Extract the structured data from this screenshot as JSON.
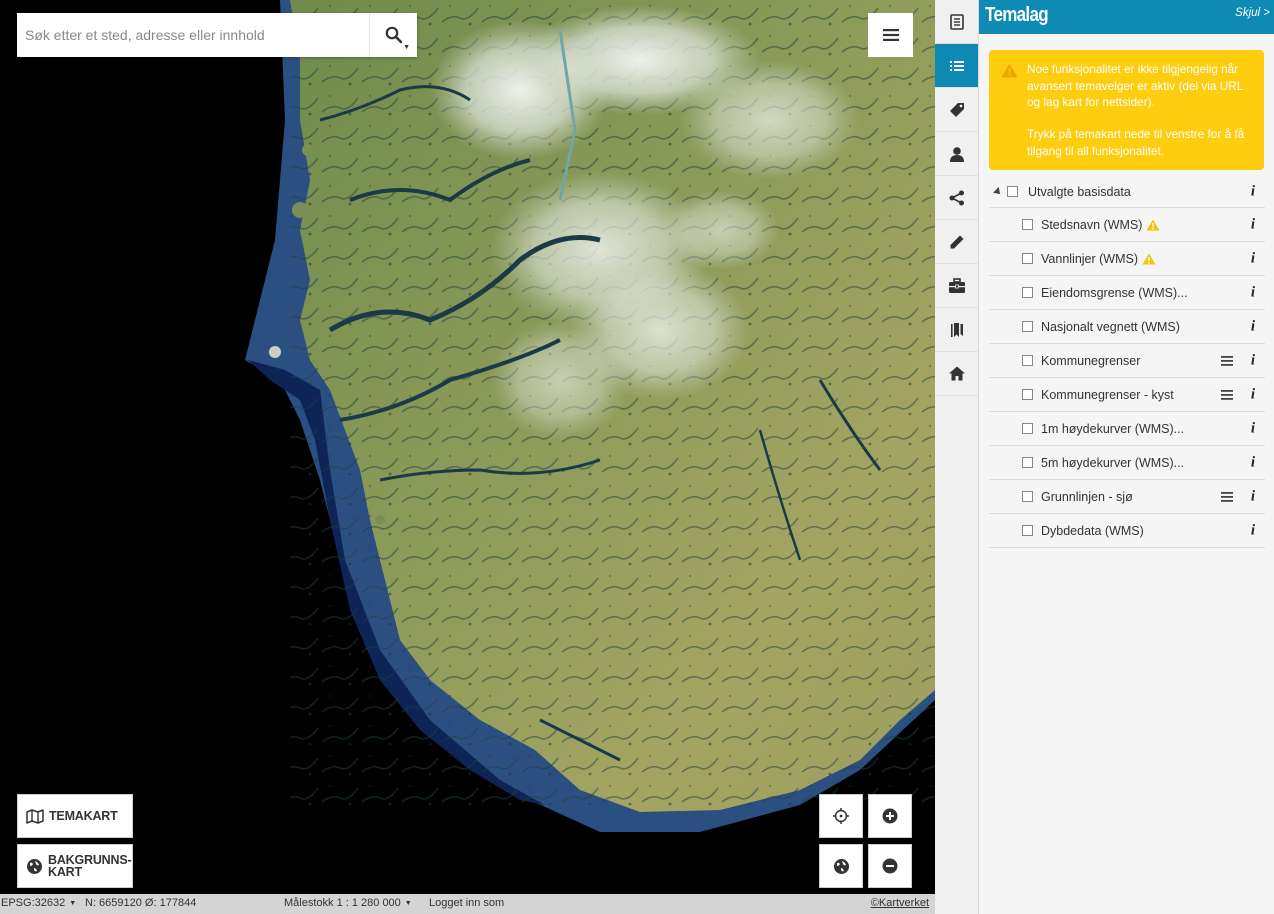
{
  "search": {
    "placeholder": "Søk etter et sted, adresse eller innhold"
  },
  "map_buttons": {
    "temakart_label": "TEMAKART",
    "bakgrunnskart_label": "BAKGRUNNS-KART"
  },
  "statusbar": {
    "projection": "EPSG:32632",
    "coordinates": "N: 6659120 Ø: 177844",
    "scale": "Målestokk 1 : 1 280 000",
    "login": "Logget inn som",
    "copyright": "©Kartverket"
  },
  "panel": {
    "title": "Temalag",
    "hide_label": "Skjul >",
    "warning_line1": "Noe funksjonalitet er ikke tilgjengelig når avansert temavelger er aktiv (del via URL og lag kart for nettsider).",
    "warning_line2": "Trykk på temakart nede til venstre for å få tilgang til all funksjonalitet.",
    "group": {
      "label": "Utvalgte basisdata"
    },
    "layers": [
      {
        "label": "Stedsnavn (WMS)"
      },
      {
        "label": "Vannlinjer (WMS)"
      },
      {
        "label": "Eiendomsgrense (WMS)..."
      },
      {
        "label": "Nasjonalt vegnett (WMS)"
      },
      {
        "label": "Kommunegrenser"
      },
      {
        "label": "Kommunegrenser - kyst"
      },
      {
        "label": "1m høydekurver (WMS)..."
      },
      {
        "label": "5m høydekurver (WMS)..."
      },
      {
        "label": "Grunnlinjen - sjø"
      },
      {
        "label": "Dybdedata (WMS)"
      }
    ],
    "info_glyph": "i"
  },
  "rail_icons": [
    "document-icon",
    "layers-list-icon",
    "tag-icon",
    "user-icon",
    "share-icon",
    "pencil-icon",
    "toolbox-icon",
    "bookmark-icon",
    "home-icon"
  ],
  "colors": {
    "accent": "#0e8ab4",
    "warning": "#ffcd10",
    "statusbar": "#d4d4d4"
  }
}
